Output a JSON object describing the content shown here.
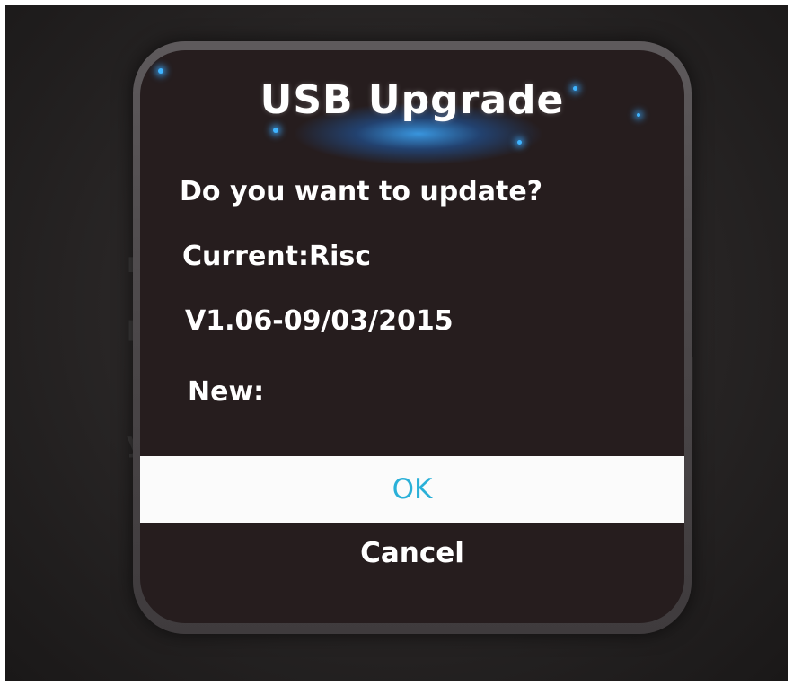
{
  "dialog": {
    "title": "USB Upgrade",
    "question": "Do you want to update?",
    "current_label": "Current:Risc",
    "current_version": "V1.06-09/03/2015",
    "new_label": "New:",
    "ok_label": "OK",
    "cancel_label": "Cancel"
  },
  "colors": {
    "dialog_background": "#261d1e",
    "ok_button_background": "#fbfbfb",
    "ok_button_text": "#2ab0d8",
    "glow_accent": "#3fb4ff",
    "text": "#ffffff"
  }
}
